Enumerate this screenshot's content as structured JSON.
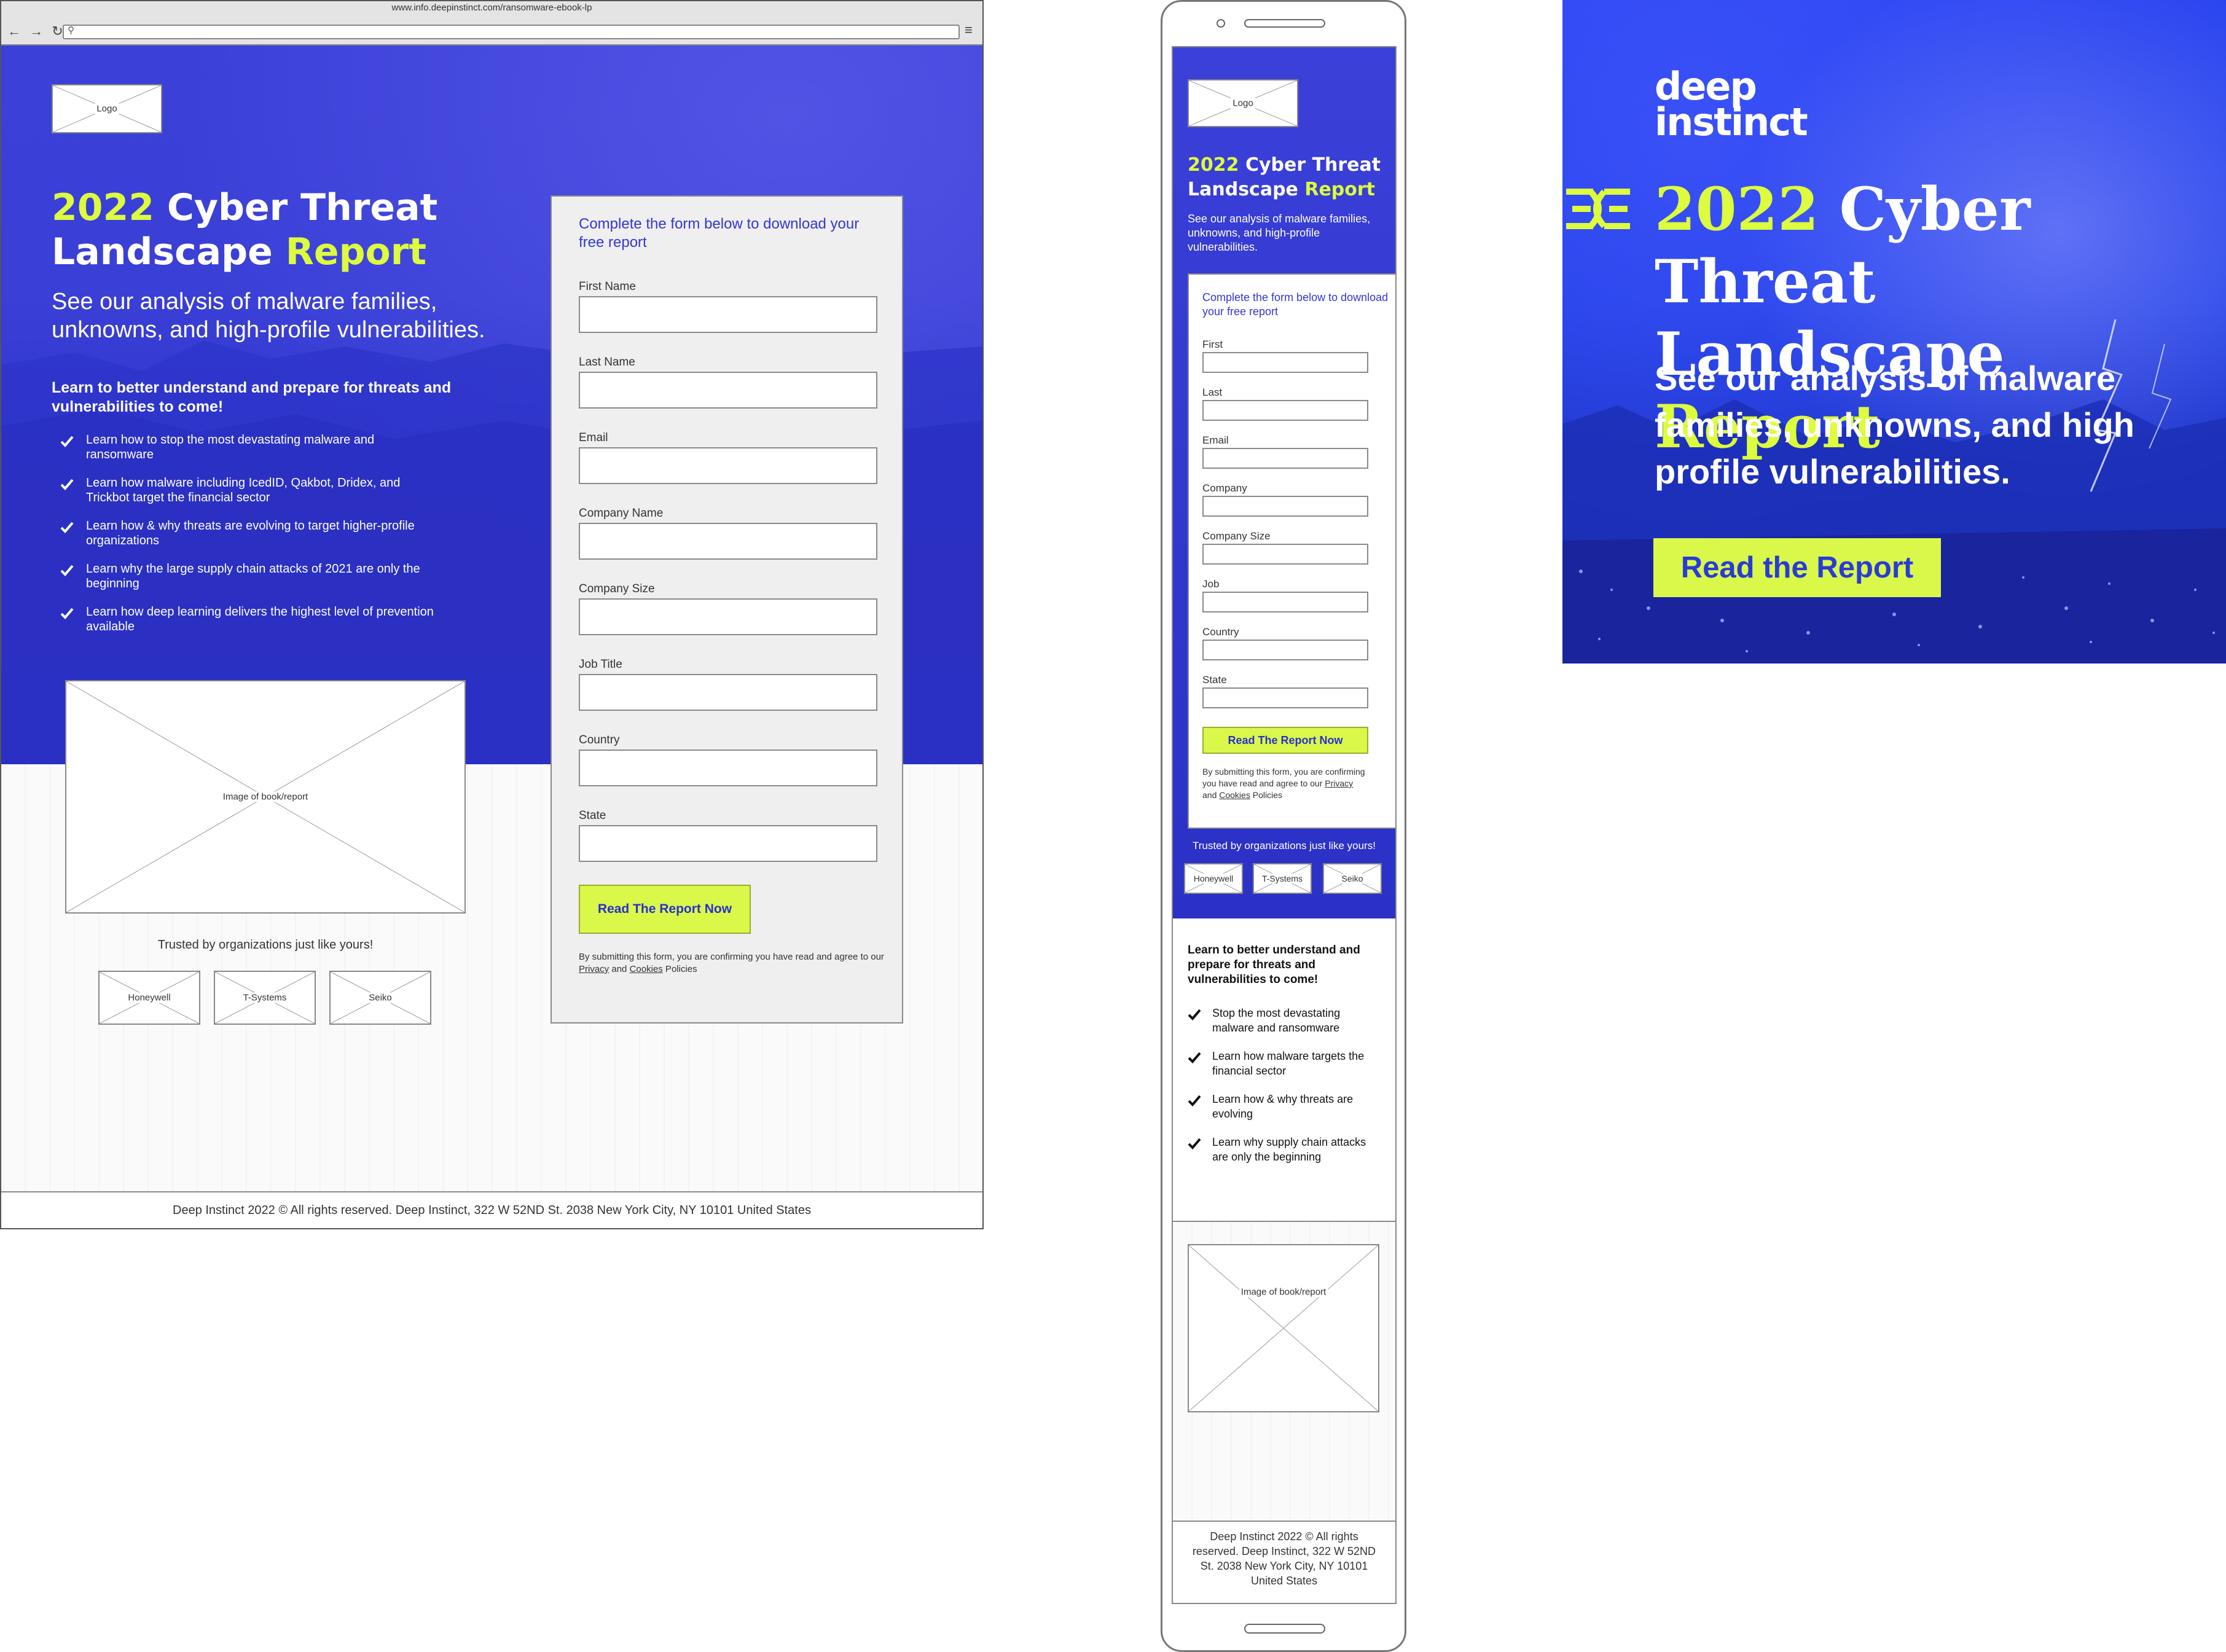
{
  "browser": {
    "url": "www.info.deepinstinct.com/ransomware-ebook-lp",
    "nav_buttons": "← → ↻",
    "search_icon": "⚲",
    "menu_icon": "≡"
  },
  "desktop": {
    "logo_label": "Logo",
    "title_year": "2022",
    "title_line1": " Cyber Threat",
    "title_line2_a": "Landscape ",
    "title_line2_b": "Report",
    "subtitle": "See our analysis of malware families, unknowns, and high-profile vulnerabilities.",
    "learn_heading": "Learn to better understand and prepare for threats and vulnerabilities to come!",
    "bullets": [
      "Learn how to stop the most devastating malware and ransomware",
      "Learn how malware including IcedID, Qakbot, Dridex, and Trickbot target the financial sector",
      "Learn how & why threats are evolving to target higher-profile organizations",
      "Learn why the large supply chain attacks of 2021 are only the beginning",
      "Learn how deep learning delivers the highest level of prevention available"
    ],
    "book_label": "Image of book/report",
    "trusted": "Trusted by organizations just like yours!",
    "company_logos": [
      "Honeywell",
      "T-Systems",
      "Seiko"
    ],
    "form": {
      "intro": "Complete the form below to download your free report",
      "fields": [
        "First Name",
        "Last Name",
        "Email",
        "Company Name",
        "Company Size",
        "Job Title",
        "Country",
        "State"
      ],
      "submit": "Read The Report Now",
      "disclaimer_pre": "By submitting this form, you are confirming you have read and agree to our ",
      "privacy": "Privacy",
      "and": " and ",
      "cookies": "Cookies",
      "disclaimer_post": " Policies"
    },
    "footer": "Deep Instinct 2022 © All rights reserved. Deep Instinct, 322 W 52ND St. 2038  New York City, NY 10101 United States"
  },
  "mobile": {
    "logo_label": "Logo",
    "title_year": "2022",
    "title_line1": " Cyber Threat",
    "title_line2_a": "Landscape ",
    "title_line2_b": "Report",
    "subtitle": "See our analysis of malware families, unknowns, and high-profile vulnerabilities.",
    "form": {
      "intro": "Complete the form below to download your free report",
      "fields": [
        "First",
        "Last",
        "Email",
        "Company",
        "Company Size",
        "Job",
        "Country",
        "State"
      ],
      "submit": "Read The Report Now",
      "disclaimer_pre": "By submitting this form, you are confirming you have read and agree to our ",
      "privacy": "Privacy",
      "and": " and ",
      "cookies": "Cookies",
      "disclaimer_post": " Policies"
    },
    "trusted": "Trusted by organizations just like yours!",
    "company_logos": [
      "Honeywell",
      "T-Systems",
      "Seiko"
    ],
    "learn_heading": "Learn to better understand and prepare for threats and vulnerabilities to come!",
    "bullets": [
      "Stop the most devastating malware and ransomware",
      "Learn how malware targets the financial sector",
      "Learn how & why threats are evolving",
      "Learn why supply chain attacks are only the beginning"
    ],
    "book_label": "Image of book/report",
    "footer": "Deep Instinct 2022 © All rights reserved. Deep Instinct, 322 W 52ND St. 2038  New York City, NY 10101 United States"
  },
  "ad": {
    "brand_line1": "deep",
    "brand_line2": "instinct",
    "title_year": "2022",
    "title_line1": " Cyber Threat",
    "title_line2_a": "Landscape ",
    "title_line2_b": "Report",
    "subtitle": "See our analysis of malware families, unknowns, and high profile vulnerabilities.",
    "cta": "Read the Report"
  },
  "colors": {
    "hero_blue": "#3a3fd6",
    "accent_lime": "#dcfc3d",
    "form_link_blue": "#3436d4",
    "ad_blue": "#2240e6"
  }
}
